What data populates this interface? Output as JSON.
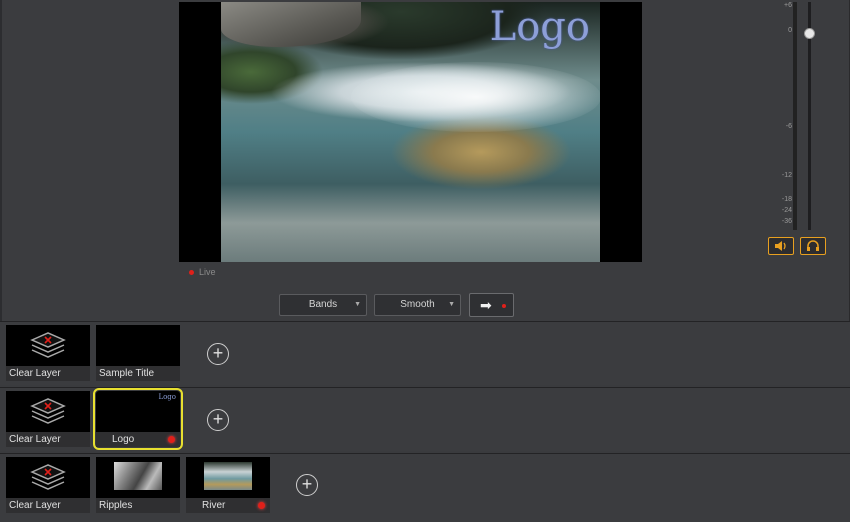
{
  "preview": {
    "logo_text": "Logo",
    "live_label": "Live"
  },
  "audio_meter": {
    "scale": [
      "+6",
      "0",
      "-6",
      "-12",
      "-18",
      "-24",
      "-36"
    ],
    "level_fraction": 0.0,
    "fader_db": 0
  },
  "audio_buttons": {
    "speaker_icon": "speaker-icon",
    "headphones_icon": "headphones-icon"
  },
  "transition": {
    "effect_value": "Bands",
    "easing_value": "Smooth",
    "go_icon": "arrow-right-icon"
  },
  "layers": [
    {
      "tiles": [
        {
          "label": "Clear Layer",
          "type": "clear"
        },
        {
          "label": "Sample Title",
          "type": "blank"
        }
      ]
    },
    {
      "tiles": [
        {
          "label": "Clear Layer",
          "type": "clear"
        },
        {
          "label": "Logo",
          "type": "logo",
          "thumb_text": "Logo",
          "live": true,
          "selected": true
        }
      ]
    },
    {
      "tiles": [
        {
          "label": "Clear Layer",
          "type": "clear"
        },
        {
          "label": "Ripples",
          "type": "ripples"
        },
        {
          "label": "River",
          "type": "river",
          "live": true
        }
      ]
    }
  ],
  "colors": {
    "accent_orange": "#e8a020",
    "selected_yellow": "#e8e030",
    "live_red": "#e0201a",
    "logo_blue": "#8d9fd8"
  }
}
